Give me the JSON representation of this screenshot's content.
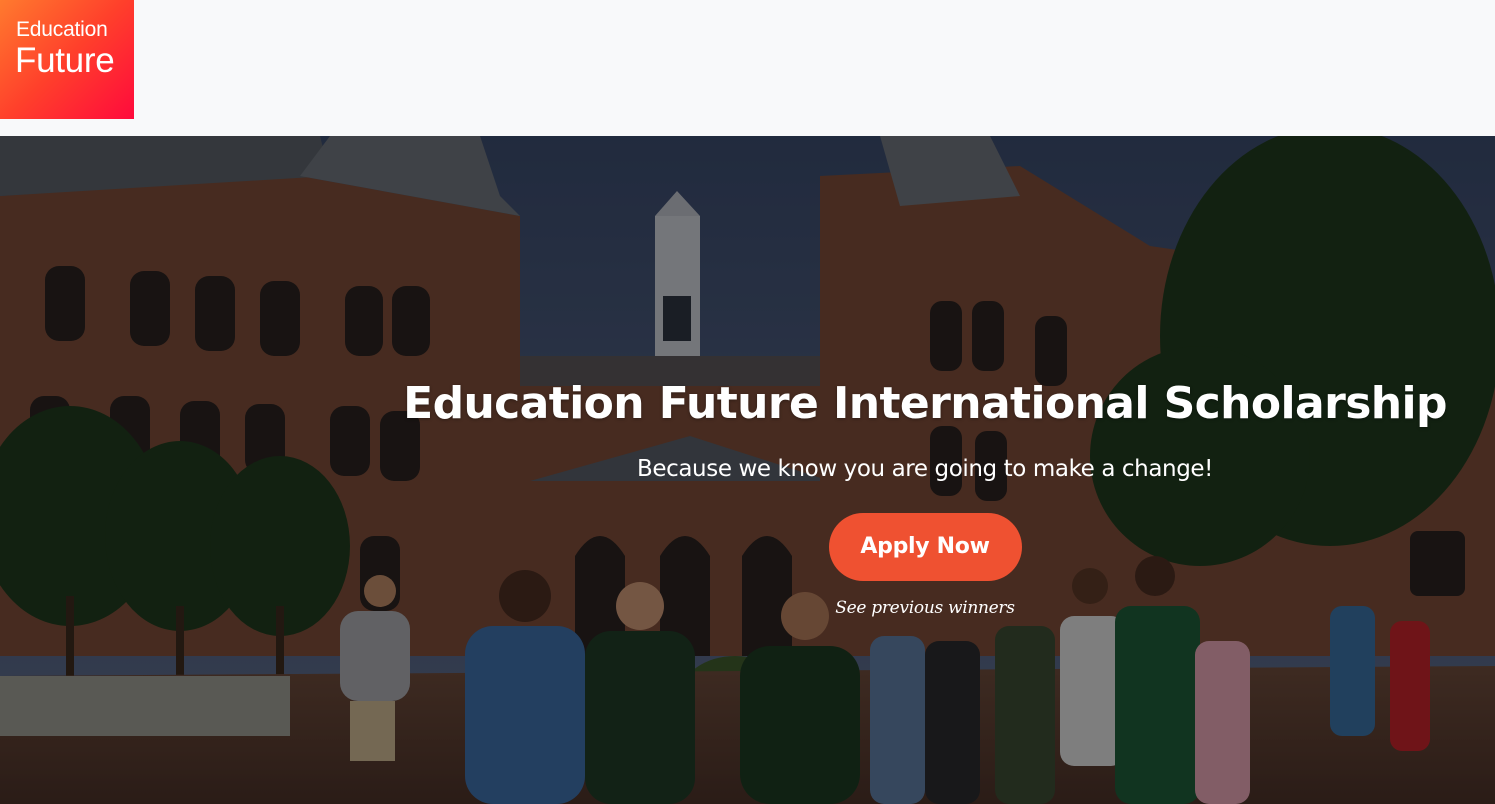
{
  "header": {
    "logo": {
      "line1": "Education",
      "line2": "Future"
    }
  },
  "hero": {
    "title": "Education Future International Scholarship",
    "subtitle": "Because we know you are going to make a change!",
    "apply_label": "Apply Now",
    "winners_link": "See previous winners"
  },
  "colors": {
    "brand_gradient_start": "#ff7a2e",
    "brand_gradient_end": "#ff0a3c",
    "button": "#ef5131",
    "hero_text": "#ffffff",
    "header_bg": "#f8f9fa"
  }
}
